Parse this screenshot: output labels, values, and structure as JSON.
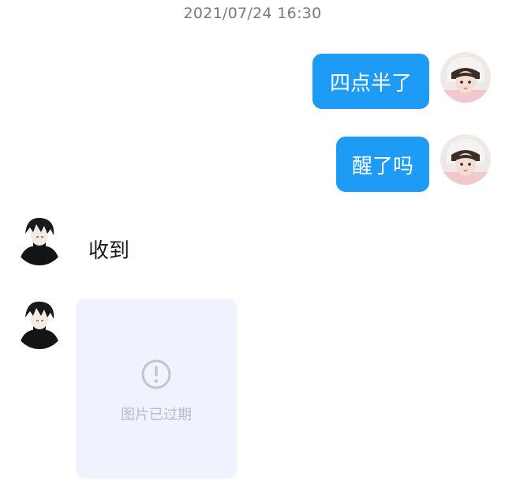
{
  "timestamp": "2021/07/24 16:30",
  "messages": [
    {
      "direction": "out",
      "type": "text",
      "text": "四点半了",
      "avatar_icon": "girl-avatar-icon"
    },
    {
      "direction": "out",
      "type": "text",
      "text": "醒了吗",
      "avatar_icon": "girl-avatar-icon"
    },
    {
      "direction": "in",
      "type": "text",
      "text": "收到",
      "avatar_icon": "anime-boy-avatar-icon"
    },
    {
      "direction": "in",
      "type": "image",
      "status_text": "图片已过期",
      "status_icon": "exclamation-circle-icon",
      "avatar_icon": "anime-boy-avatar-icon"
    }
  ],
  "colors": {
    "outgoing_bubble": "#1e9bf5",
    "expired_card_bg": "#eef3fd"
  }
}
